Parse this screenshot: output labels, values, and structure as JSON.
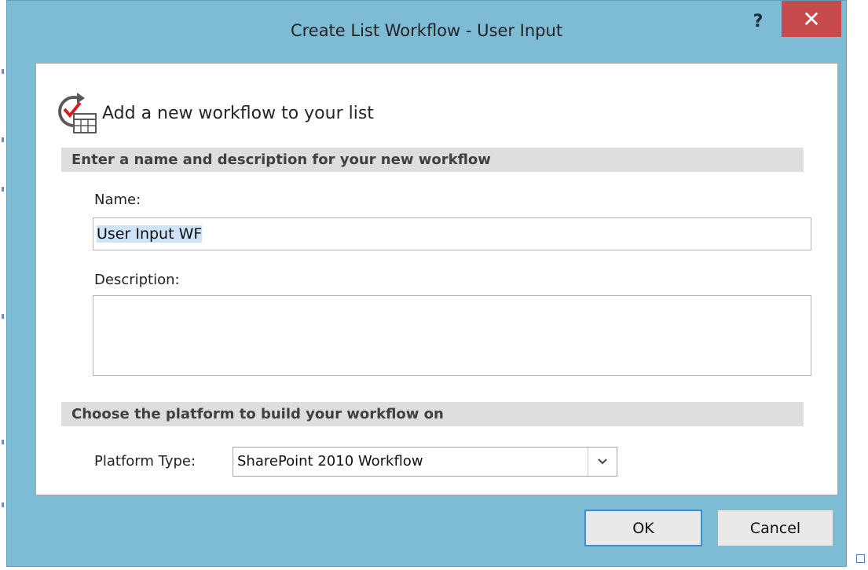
{
  "window": {
    "title": "Create List Workflow - User Input",
    "help_label": "?",
    "close_label": "✕"
  },
  "header": {
    "icon": "workflow-list-icon",
    "text": "Add a new workflow to your list"
  },
  "section_name": {
    "title": "Enter a name and description for your new workflow",
    "name_label": "Name:",
    "name_value": "User Input WF",
    "description_label": "Description:",
    "description_value": ""
  },
  "section_platform": {
    "title": "Choose the platform to build your workflow on",
    "platform_label": "Platform Type:",
    "platform_value": "SharePoint 2010 Workflow"
  },
  "buttons": {
    "ok": "OK",
    "cancel": "Cancel"
  },
  "colors": {
    "chrome": "#7ebcd6",
    "close": "#c74b4b",
    "section_bar": "#dedede",
    "selection": "#cfe3f8",
    "focus_border": "#3c8ccf"
  }
}
